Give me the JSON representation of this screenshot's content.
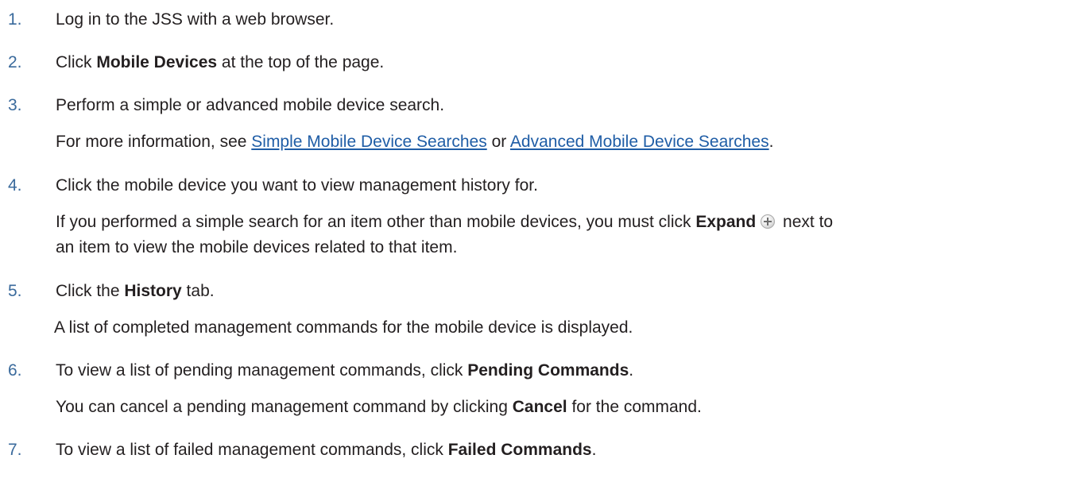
{
  "steps": [
    {
      "number": "1.",
      "text": "Log in to the JSS with a web browser."
    },
    {
      "number": "2.",
      "before": "Click ",
      "bold": "Mobile Devices",
      "after": " at the top of the page."
    },
    {
      "number": "3.",
      "text": "Perform a simple or advanced mobile device search.",
      "note_before": "For more information, see ",
      "link1": "Simple Mobile Device Searches",
      "note_middle": " or ",
      "link2": "Advanced Mobile Device Searches",
      "note_after": "."
    },
    {
      "number": "4.",
      "text": "Click the mobile device you want to view management history for.",
      "note_before": "If you performed a simple search for an item other than mobile devices, you must click ",
      "note_bold": "Expand",
      "icon": "expand-plus-icon",
      "note_after": " next to",
      "note_line2": "an item to view the mobile devices related to that item."
    },
    {
      "number": "5.",
      "before": "Click the ",
      "bold": "History",
      "after": " tab.",
      "note": "A list of completed management commands for the mobile device is displayed."
    },
    {
      "number": "6.",
      "before": "To view a list of pending management commands, click ",
      "bold": "Pending Commands",
      "after": ".",
      "note_before": "You can cancel a pending management command by clicking ",
      "note_bold": "Cancel",
      "note_after": " for the command."
    },
    {
      "number": "7.",
      "before": "To view a list of failed management commands, click ",
      "bold": "Failed Commands",
      "after": "."
    }
  ]
}
